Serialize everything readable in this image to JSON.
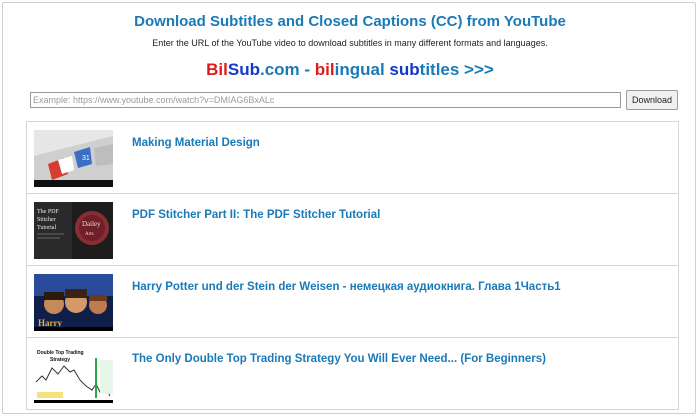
{
  "header": {
    "title": "Download Subtitles and Closed Captions (CC) from YouTube",
    "subtitle": "Enter the URL of the YouTube video to download subtitles in many different formats and languages.",
    "promo": {
      "part1": "Bil",
      "part2": "Sub",
      "part3": ".com - ",
      "part4": "bil",
      "part5": "ingual ",
      "part6": "sub",
      "part7": "titles >>>"
    }
  },
  "search": {
    "placeholder": "Example: https://www.youtube.com/watch?v=DMIAG6BxALc",
    "value": "",
    "button_label": "Download"
  },
  "videos": [
    {
      "title": "Making Material Design",
      "thumb": "material-design-thumbnail",
      "thumb_text": ""
    },
    {
      "title": "PDF Stitcher Part II: The PDF Stitcher Tutorial",
      "thumb": "pdf-stitcher-thumbnail",
      "thumb_text": "The PDF Stitcher Tutorial"
    },
    {
      "title": "Harry Potter und der Stein der Weisen - немецкая аудиокнига. Глава 1Часть1",
      "thumb": "harry-potter-thumbnail",
      "thumb_text": ""
    },
    {
      "title": "The Only Double Top Trading Strategy You Will Ever Need... (For Beginners)",
      "thumb": "trading-strategy-thumbnail",
      "thumb_text": "Double Top Trading Strategy"
    }
  ],
  "colors": {
    "link": "#1a7ab8",
    "red": "#e01919",
    "blue": "#1438c8"
  }
}
